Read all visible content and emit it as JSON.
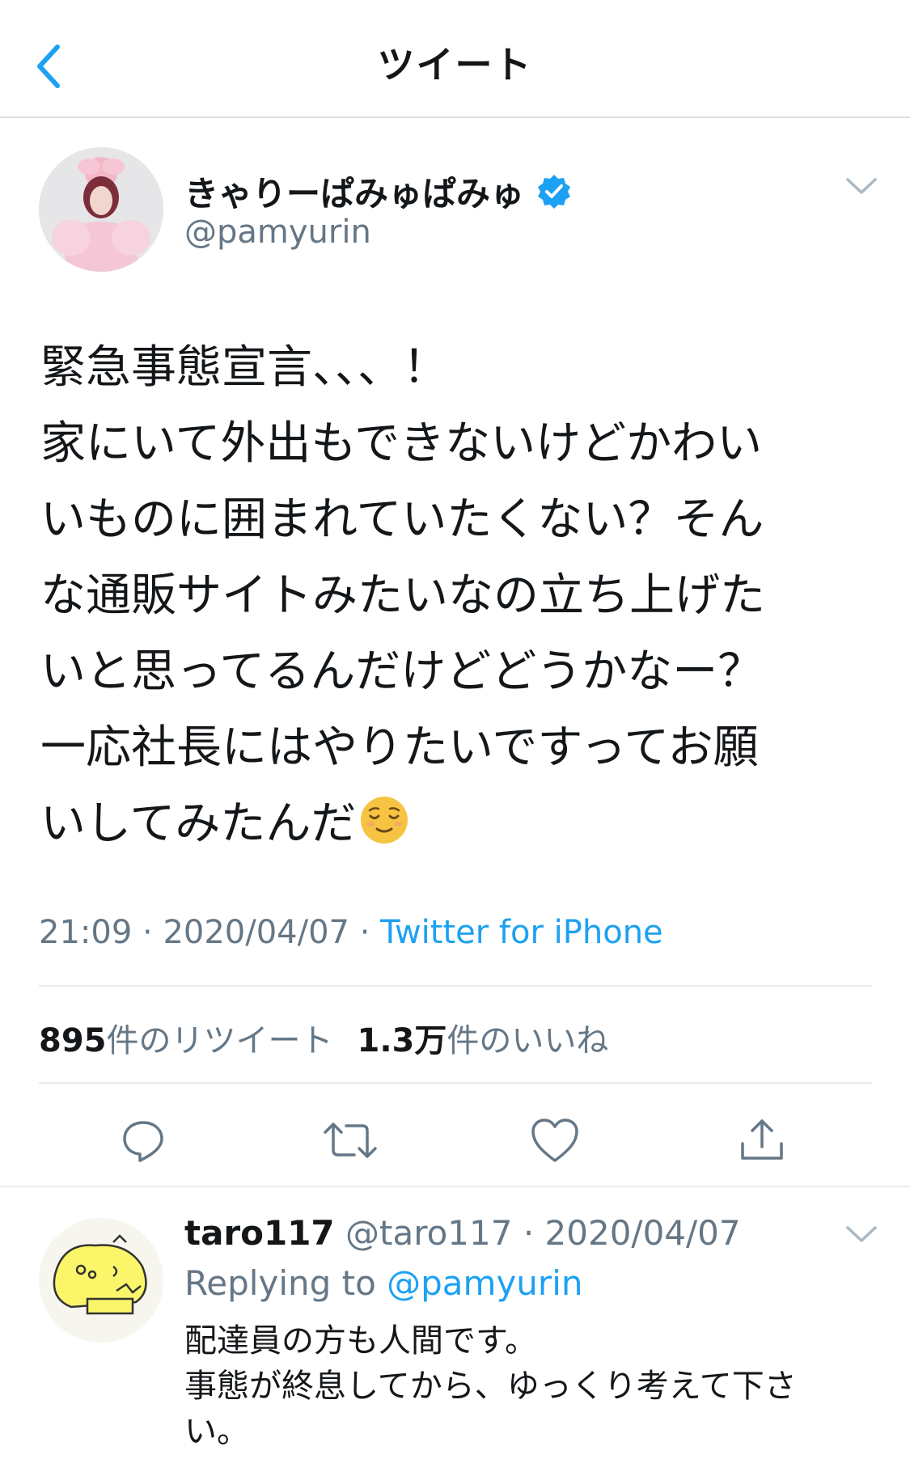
{
  "header": {
    "title": "ツイート"
  },
  "tweet": {
    "display_name": "きゃりーぱみゅぱみゅ",
    "handle": "@pamyurin",
    "text_lines": [
      "緊急事態宣言、、、！",
      "家にいて外出もできないけどかわい",
      "いものに囲まれていたくない？そん",
      "な通販サイトみたいなの立ち上げた",
      "いと思ってるんだけどどうかなー？",
      "一応社長にはやりたいですってお願",
      "いしてみたんだ"
    ],
    "emoji": "relieved-face",
    "time": "21:09",
    "date": "2020/04/07",
    "separator": " · ",
    "source": "Twitter for iPhone",
    "retweet_count": "895",
    "retweet_label": "件のリツイート",
    "like_count": "1.3万",
    "like_label": "件のいいね"
  },
  "actions": {
    "icons": [
      "reply-icon",
      "retweet-icon",
      "like-icon",
      "share-icon"
    ]
  },
  "reply": {
    "display_name": "taro117",
    "handle": "@taro117",
    "separator": "·",
    "date": "2020/04/07",
    "replying_prefix": "Replying to ",
    "replying_to": "@pamyurin",
    "text_lines": [
      "配達員の方も人間です。",
      "事態が終息してから、ゆっくり考えて下さ",
      "い。"
    ]
  },
  "colors": {
    "accent": "#1da1f2",
    "text": "#14171a",
    "muted": "#657786",
    "divider": "#e6ecf0"
  }
}
